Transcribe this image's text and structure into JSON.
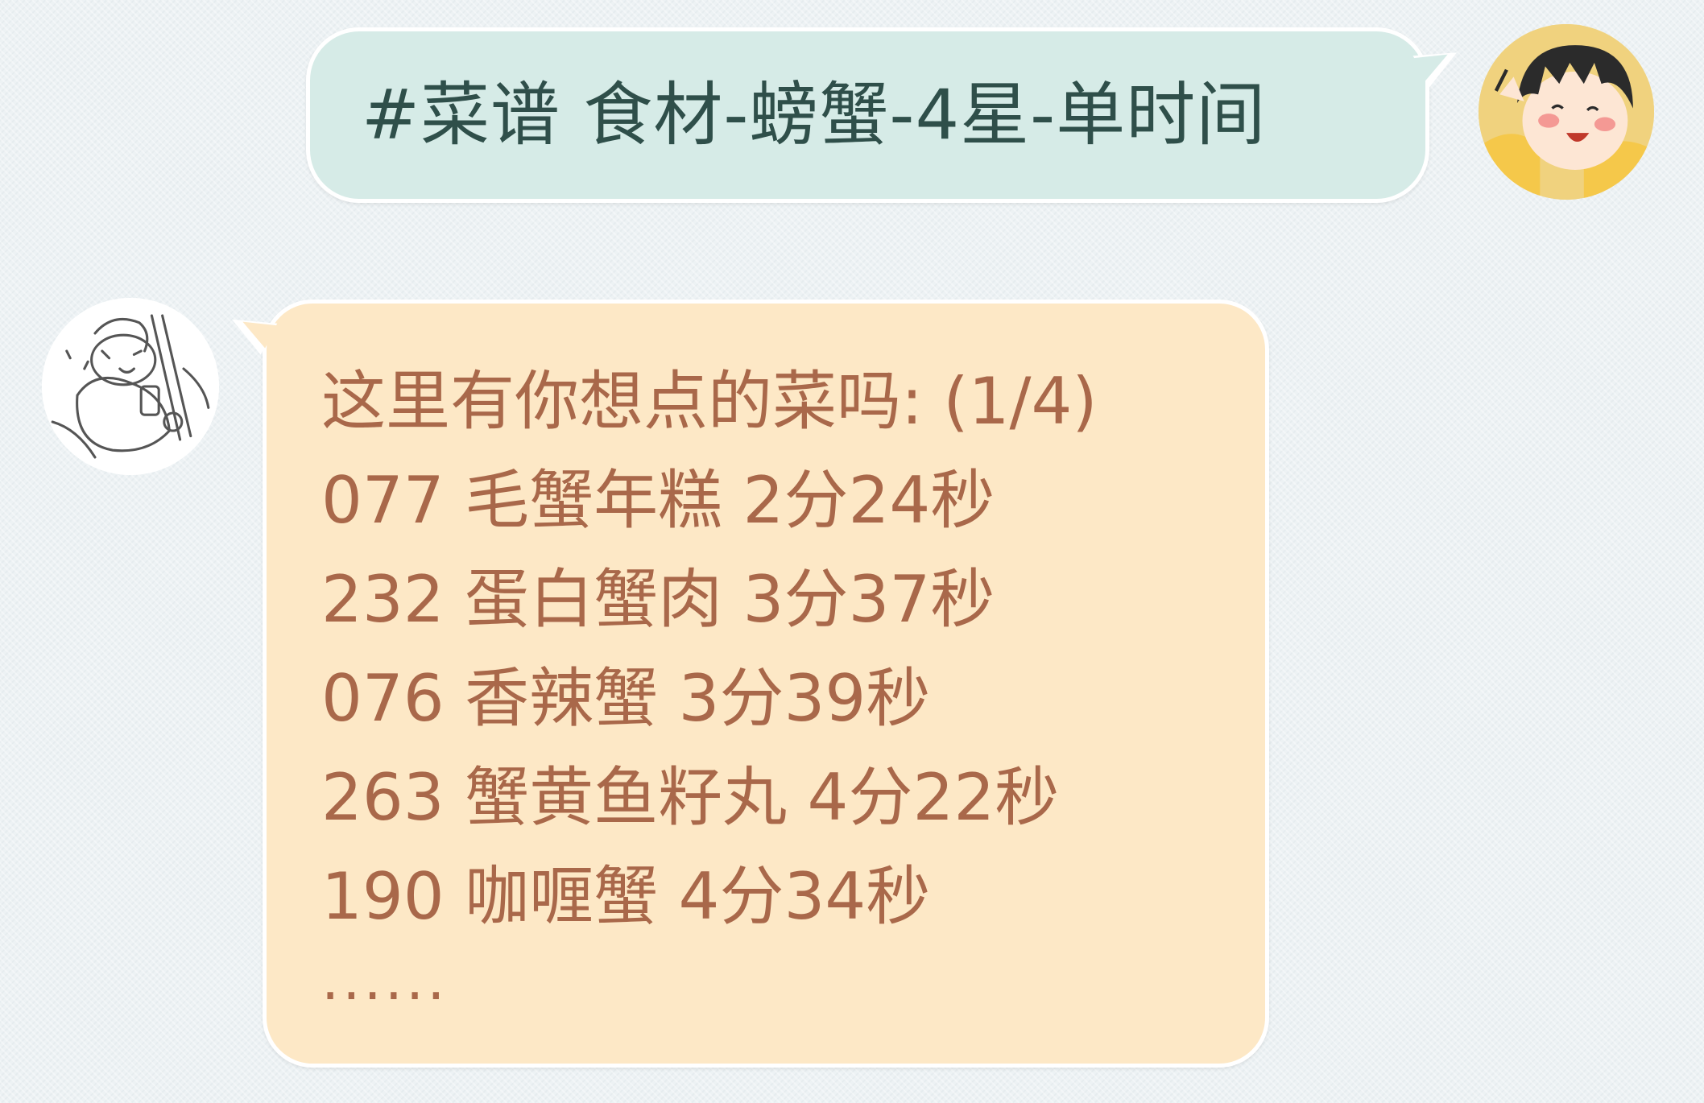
{
  "chat": {
    "outgoing": {
      "text": "#菜谱 食材-螃蟹-4星-单时间",
      "bubble_color": "#d6ebe7",
      "text_color": "#2f4f4a",
      "avatar_icon": "girl-avatar-icon"
    },
    "incoming": {
      "bubble_color": "#fde8c6",
      "text_color": "#a9684a",
      "avatar_icon": "bird-musician-avatar-icon",
      "header": "这里有你想点的菜吗: (1/4)",
      "lines": [
        "077 毛蟹年糕 2分24秒",
        "232 蛋白蟹肉 3分37秒",
        "076 香辣蟹 3分39秒",
        "263 蟹黄鱼籽丸 4分22秒",
        "190 咖喱蟹 4分34秒"
      ],
      "ellipsis": "......"
    }
  }
}
